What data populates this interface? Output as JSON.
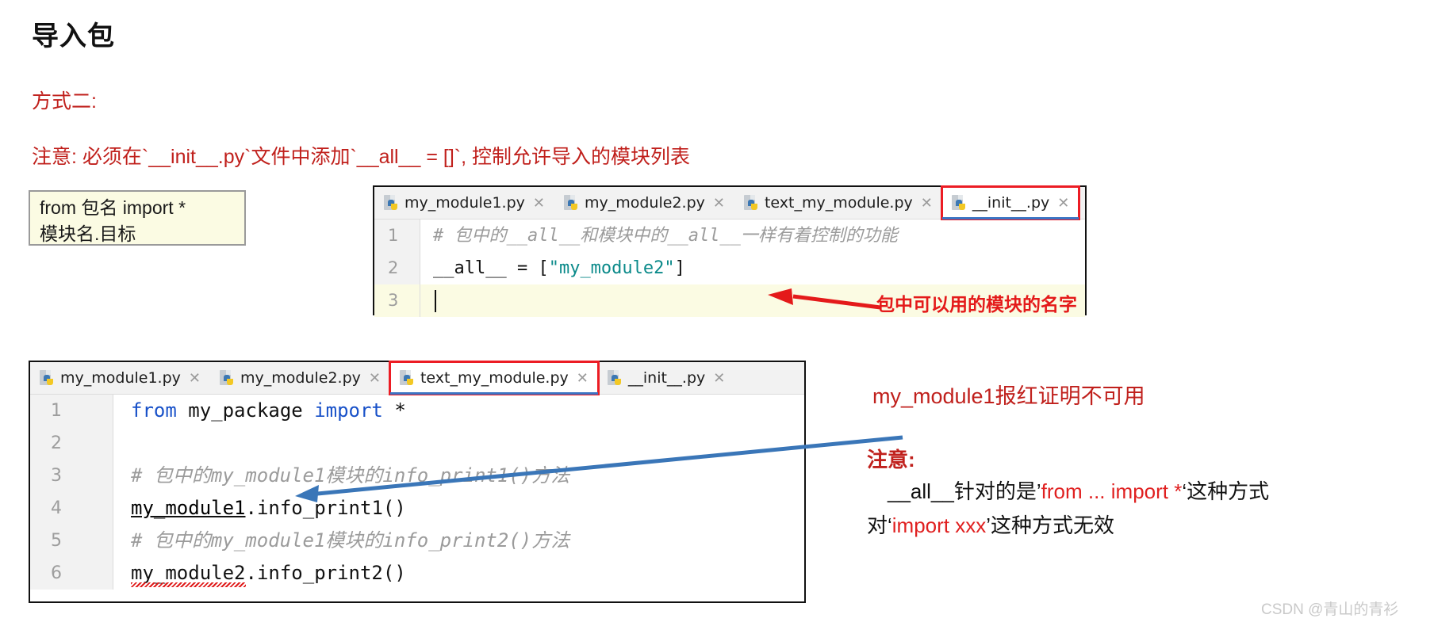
{
  "page": {
    "title": "导入包",
    "method_label": "方式二:",
    "note_line": "注意: 必须在`__init__.py`文件中添加`__all__ = []`, 控制允许导入的模块列表",
    "watermark": "CSDN @青山的青衫",
    "colors": {
      "red": "#c0201c",
      "bright_red": "#e41a1a",
      "blue_keyword": "#1750c8",
      "string_teal": "#0b8a8a",
      "comment_gray": "#9b9b9b",
      "tab_active_underline": "#3b74c4",
      "highlight_box": "#ec1c24",
      "syntax_box_bg": "#fbfbe3"
    }
  },
  "syntax_box": {
    "line1": "from 包名 import *",
    "line2": "模块名.目标"
  },
  "editor1": {
    "tabs": [
      {
        "label": "my_module1.py",
        "icon": "python-file-icon",
        "close": "✕",
        "active": false,
        "highlighted": false
      },
      {
        "label": "my_module2.py",
        "icon": "python-file-icon",
        "close": "✕",
        "active": false,
        "highlighted": false
      },
      {
        "label": "text_my_module.py",
        "icon": "python-file-icon",
        "close": "✕",
        "active": false,
        "highlighted": false
      },
      {
        "label": "__init__.py",
        "icon": "python-file-icon",
        "close": "✕",
        "active": true,
        "highlighted": true
      }
    ],
    "line_numbers": [
      "1",
      "2",
      "3"
    ],
    "lines": [
      {
        "n": "1",
        "current": false,
        "tokens": [
          {
            "t": "# 包中的__all__和模块中的__all__一样有着控制的功能",
            "c": "cmt"
          }
        ]
      },
      {
        "n": "2",
        "current": false,
        "tokens": [
          {
            "t": "__all__ = [",
            "c": "plain"
          },
          {
            "t": "\"my_module2\"",
            "c": "str"
          },
          {
            "t": "]",
            "c": "plain"
          }
        ]
      },
      {
        "n": "3",
        "current": true,
        "tokens": [
          {
            "t": "",
            "c": "plain"
          }
        ]
      }
    ]
  },
  "editor2": {
    "tabs": [
      {
        "label": "my_module1.py",
        "icon": "python-file-icon",
        "close": "✕",
        "active": false,
        "highlighted": false
      },
      {
        "label": "my_module2.py",
        "icon": "python-file-icon",
        "close": "✕",
        "active": false,
        "highlighted": false
      },
      {
        "label": "text_my_module.py",
        "icon": "python-file-icon",
        "close": "✕",
        "active": true,
        "highlighted": true
      },
      {
        "label": "__init__.py",
        "icon": "python-file-icon",
        "close": "✕",
        "active": false,
        "highlighted": false
      }
    ],
    "line_numbers": [
      "1",
      "2",
      "3",
      "4",
      "5",
      "6"
    ],
    "lines": [
      {
        "n": "1",
        "current": false,
        "tokens": [
          {
            "t": "from",
            "c": "kw"
          },
          {
            "t": " my_package ",
            "c": "plain"
          },
          {
            "t": "import",
            "c": "kw"
          },
          {
            "t": " *",
            "c": "plain"
          }
        ]
      },
      {
        "n": "2",
        "current": false,
        "tokens": [
          {
            "t": "",
            "c": "plain"
          }
        ]
      },
      {
        "n": "3",
        "current": false,
        "tokens": [
          {
            "t": "# 包中的my_module1模块的info_print1()方法",
            "c": "cmt"
          }
        ]
      },
      {
        "n": "4",
        "current": false,
        "error_token": "my_module1",
        "tokens": [
          {
            "t": "my_module1",
            "c": "err"
          },
          {
            "t": ".info_print1()",
            "c": "plain"
          }
        ]
      },
      {
        "n": "5",
        "current": false,
        "tokens": [
          {
            "t": "# 包中的my_module1模块的info_print2()方法",
            "c": "cmt"
          }
        ]
      },
      {
        "n": "6",
        "current": false,
        "tokens": [
          {
            "t": "my_module2.info_print2()",
            "c": "plain"
          }
        ]
      }
    ]
  },
  "annotations": {
    "red_note_1": "包中可以用的模块的名字",
    "red_note_2": "my_module1报红证明不可用",
    "attention_title": "注意:",
    "attention_line1_a": "　__all__针对的是’",
    "attention_line1_red": "from ... import *",
    "attention_line1_b": "‘这种方式",
    "attention_line2_a": "对‘",
    "attention_line2_red": "import xxx",
    "attention_line2_b": "’这种方式无效"
  }
}
